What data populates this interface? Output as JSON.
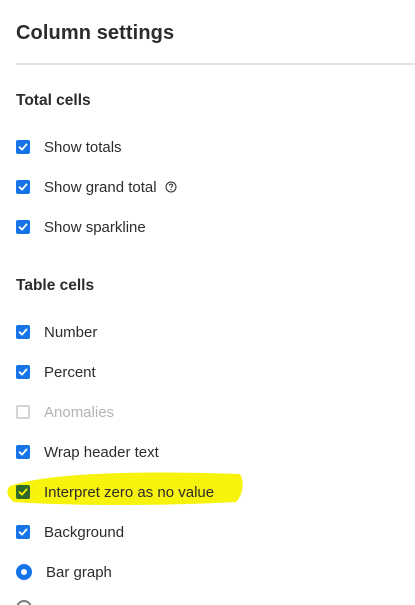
{
  "panel": {
    "title": "Column settings"
  },
  "total_cells": {
    "heading": "Total cells",
    "items": [
      {
        "label": "Show totals",
        "checked": true
      },
      {
        "label": "Show grand total",
        "checked": true,
        "has_help_icon": true
      },
      {
        "label": "Show sparkline",
        "checked": true
      }
    ]
  },
  "table_cells": {
    "heading": "Table cells",
    "items": [
      {
        "label": "Number",
        "checked": true
      },
      {
        "label": "Percent",
        "checked": true
      },
      {
        "label": "Anomalies",
        "checked": false,
        "disabled": true
      },
      {
        "label": "Wrap header text",
        "checked": true
      },
      {
        "label": "Interpret zero as no value",
        "checked": true,
        "highlighted": true
      },
      {
        "label": "Background",
        "checked": true
      }
    ]
  },
  "background_options": {
    "items": [
      {
        "label": "Bar graph",
        "selected": true
      }
    ]
  },
  "colors": {
    "accent": "#1473e6",
    "highlight": "#f7f200",
    "disabled_text": "#b3b3b3"
  },
  "icons": {
    "checkmark": "checkmark-icon",
    "help": "help-circle-icon"
  }
}
